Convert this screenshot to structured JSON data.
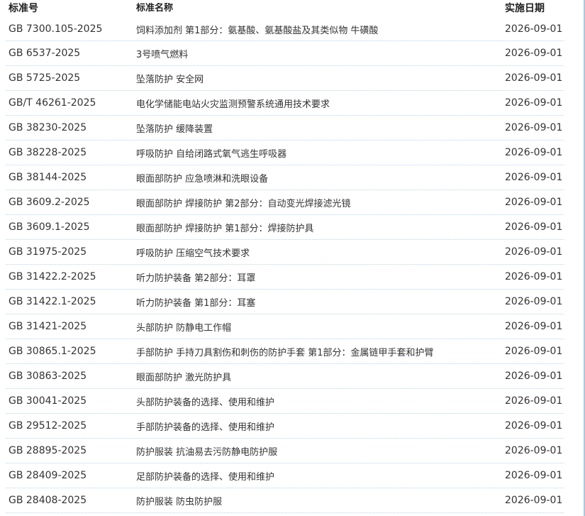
{
  "table": {
    "headers": {
      "code": "标准号",
      "name": "标准名称",
      "date": "实施日期"
    },
    "rows": [
      {
        "code": "GB 7300.105-2025",
        "name": "饲料添加剂 第1部分：氨基酸、氨基酸盐及其类似物 牛磺酸",
        "date": "2026-09-01"
      },
      {
        "code": "GB 6537-2025",
        "name": "3号喷气燃料",
        "date": "2026-09-01"
      },
      {
        "code": "GB 5725-2025",
        "name": "坠落防护 安全网",
        "date": "2026-09-01"
      },
      {
        "code": "GB/T 46261-2025",
        "name": "电化学储能电站火灾监测预警系统通用技术要求",
        "date": "2026-09-01"
      },
      {
        "code": "GB 38230-2025",
        "name": "坠落防护 缓降装置",
        "date": "2026-09-01"
      },
      {
        "code": "GB 38228-2025",
        "name": "呼吸防护 自给闭路式氧气逃生呼吸器",
        "date": "2026-09-01"
      },
      {
        "code": "GB 38144-2025",
        "name": "眼面部防护 应急喷淋和洗眼设备",
        "date": "2026-09-01"
      },
      {
        "code": "GB 3609.2-2025",
        "name": "眼面部防护 焊接防护 第2部分：自动变光焊接滤光镜",
        "date": "2026-09-01"
      },
      {
        "code": "GB 3609.1-2025",
        "name": "眼面部防护 焊接防护 第1部分：焊接防护具",
        "date": "2026-09-01"
      },
      {
        "code": "GB 31975-2025",
        "name": "呼吸防护 压缩空气技术要求",
        "date": "2026-09-01"
      },
      {
        "code": "GB 31422.2-2025",
        "name": "听力防护装备 第2部分：耳罩",
        "date": "2026-09-01"
      },
      {
        "code": "GB 31422.1-2025",
        "name": "听力防护装备 第1部分：耳塞",
        "date": "2026-09-01"
      },
      {
        "code": "GB 31421-2025",
        "name": "头部防护 防静电工作帽",
        "date": "2026-09-01"
      },
      {
        "code": "GB 30865.1-2025",
        "name": "手部防护 手持刀具割伤和刺伤的防护手套 第1部分：金属链甲手套和护臂",
        "date": "2026-09-01"
      },
      {
        "code": "GB 30863-2025",
        "name": "眼面部防护 激光防护具",
        "date": "2026-09-01"
      },
      {
        "code": "GB 30041-2025",
        "name": "头部防护装备的选择、使用和维护",
        "date": "2026-09-01"
      },
      {
        "code": "GB 29512-2025",
        "name": "手部防护装备的选择、使用和维护",
        "date": "2026-09-01"
      },
      {
        "code": "GB 28895-2025",
        "name": "防护服装 抗油易去污防静电防护服",
        "date": "2026-09-01"
      },
      {
        "code": "GB 28409-2025",
        "name": "足部防护装备的选择、使用和维护",
        "date": "2026-09-01"
      },
      {
        "code": "GB 28408-2025",
        "name": "防护服装 防虫防护服",
        "date": "2026-09-01"
      }
    ]
  }
}
